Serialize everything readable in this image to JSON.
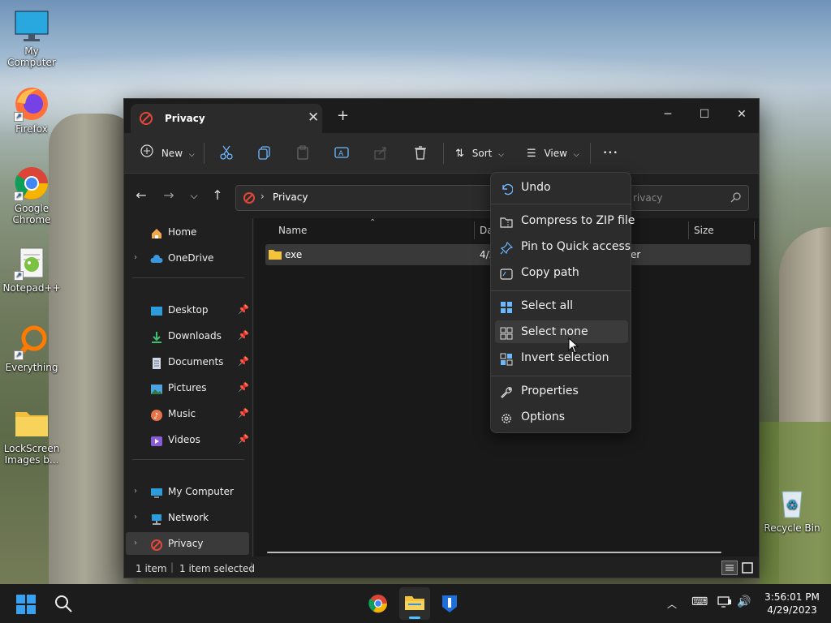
{
  "desktop": {
    "icons": [
      {
        "label": "My Computer"
      },
      {
        "label": "Firefox"
      },
      {
        "label": "Google Chrome"
      },
      {
        "label": "Notepad++"
      },
      {
        "label": "Everything"
      },
      {
        "label": "LockScreen Images b..."
      },
      {
        "label": "Recycle Bin"
      }
    ]
  },
  "window": {
    "tab_title": "Privacy",
    "close_tab_glyph": "✕",
    "new_tab_glyph": "+",
    "controls": {
      "minimize": "─",
      "maximize": "☐",
      "close": "✕"
    }
  },
  "toolbar": {
    "new_label": "New",
    "sort_label": "Sort",
    "view_label": "View",
    "more_glyph": "•••"
  },
  "nav": {
    "address_segment": "Privacy",
    "search_placeholder": "rivacy"
  },
  "sidebar": {
    "items": [
      {
        "label": "Home"
      },
      {
        "label": "OneDrive"
      },
      {
        "label": "Desktop"
      },
      {
        "label": "Downloads"
      },
      {
        "label": "Documents"
      },
      {
        "label": "Pictures"
      },
      {
        "label": "Music"
      },
      {
        "label": "Videos"
      },
      {
        "label": "My Computer"
      },
      {
        "label": "Network"
      },
      {
        "label": "Privacy"
      }
    ]
  },
  "columns": {
    "name": "Name",
    "date": "Da",
    "size": "Size"
  },
  "files": [
    {
      "name": "exe",
      "date": "4/2",
      "type": "er"
    }
  ],
  "status": {
    "count": "1 item",
    "selected": "1 item selected"
  },
  "context_menu": {
    "items": [
      {
        "label": "Undo"
      },
      {
        "label": "Compress to ZIP file"
      },
      {
        "label": "Pin to Quick access"
      },
      {
        "label": "Copy path"
      },
      {
        "label": "Select all"
      },
      {
        "label": "Select none"
      },
      {
        "label": "Invert selection"
      },
      {
        "label": "Properties"
      },
      {
        "label": "Options"
      }
    ]
  },
  "taskbar": {
    "time": "3:56:01 PM",
    "date": "4/29/2023"
  },
  "colors": {
    "accent": "#4cc2ff",
    "privacy_red": "#e0473a",
    "folder_yellow": "#f5c33b"
  }
}
